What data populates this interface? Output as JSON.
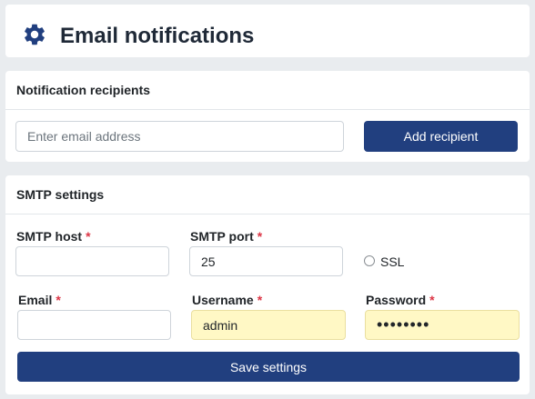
{
  "header": {
    "title": "Email notifications",
    "icon": "gear-icon"
  },
  "recipients": {
    "heading": "Notification recipients",
    "email_placeholder": "Enter email address",
    "add_label": "Add recipient"
  },
  "smtp": {
    "heading": "SMTP settings",
    "host_label": "SMTP host",
    "host_value": "",
    "port_label": "SMTP port",
    "port_value": "25",
    "ssl_label": "SSL",
    "ssl_checked": false,
    "email_label": "Email",
    "email_value": "",
    "username_label": "Username",
    "username_value": "admin",
    "password_label": "Password",
    "password_value": "12345678",
    "required_mark": "*",
    "save_label": "Save settings"
  },
  "colors": {
    "primary": "#213f7f",
    "required": "#dc3545",
    "autofill": "#fff8c5",
    "background": "#e9ecef"
  }
}
